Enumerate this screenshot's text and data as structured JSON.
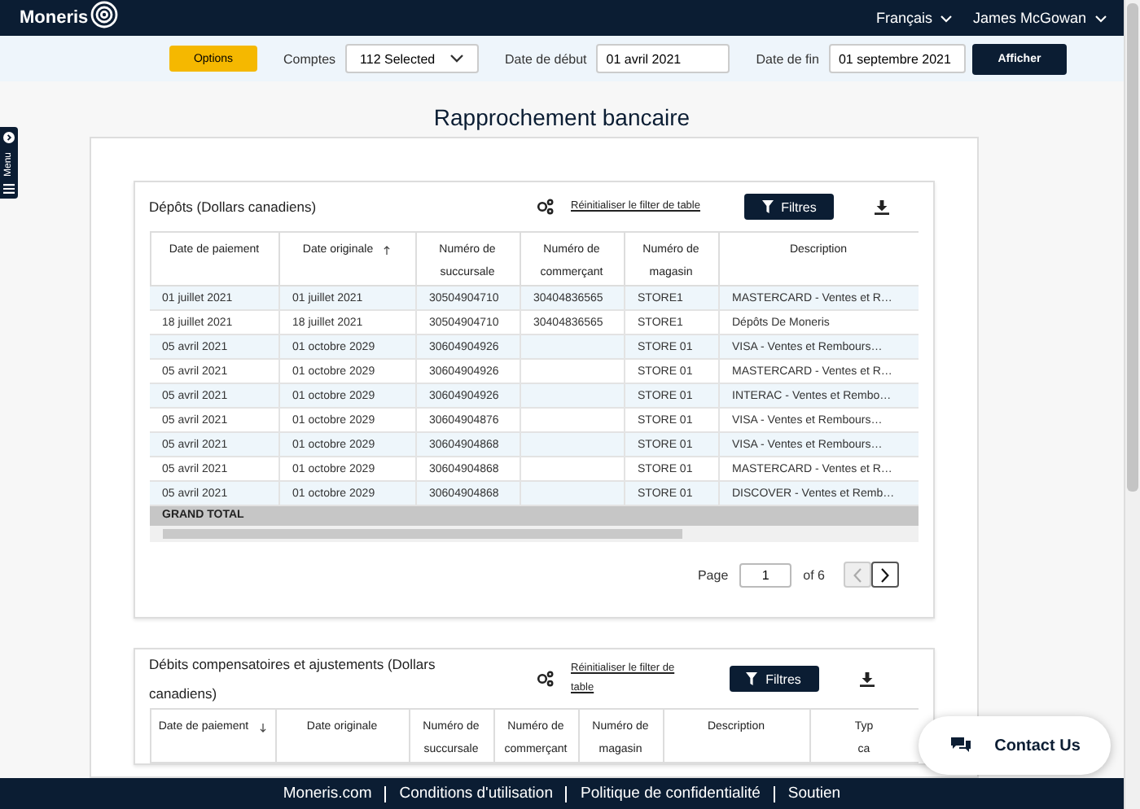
{
  "header": {
    "logo": "Moneris",
    "language": "Français",
    "user": "James McGowan"
  },
  "toolbar": {
    "options_button": "Options",
    "accounts": {
      "label": "Comptes",
      "value": "112 Selected"
    },
    "start_date": {
      "label": "Date de début",
      "value": "01 avril 2021"
    },
    "end_date": {
      "label": "Date de fin",
      "value": "01 septembre 2021"
    },
    "submit_button": "Afficher"
  },
  "side_menu": {
    "label": "Menu"
  },
  "page_title": "Rapprochement bancaire",
  "sections": [
    {
      "title": "Dépôts (Dollars canadiens)",
      "reset_link": "Réinitialiser le filter de table",
      "filter_button": "Filtres",
      "columns": [
        {
          "label": "Date de paiement",
          "sorted": false
        },
        {
          "label": "Date originale",
          "sorted": true,
          "ascending": true
        },
        {
          "label": "Numéro de succursale",
          "sorted": false
        },
        {
          "label": "Numéro de commerçant",
          "sorted": false
        },
        {
          "label": "Numéro de magasin",
          "sorted": false
        },
        {
          "label": "Description",
          "sorted": false
        }
      ],
      "rows": [
        [
          "01 juillet 2021",
          "01 juillet 2021",
          "30504904710",
          "30404836565",
          "STORE1",
          "MASTERCARD - Ventes et R…"
        ],
        [
          "18 juillet 2021",
          "18 juillet 2021",
          "30504904710",
          "30404836565",
          "STORE1",
          "Dépôts De Moneris"
        ],
        [
          "05 avril 2021",
          "01 octobre 2029",
          "30604904926",
          null,
          "STORE 01",
          "VISA - Ventes et Rembours…"
        ],
        [
          "05 avril 2021",
          "01 octobre 2029",
          "30604904926",
          null,
          "STORE 01",
          "MASTERCARD - Ventes et R…"
        ],
        [
          "05 avril 2021",
          "01 octobre 2029",
          "30604904926",
          null,
          "STORE 01",
          "INTERAC - Ventes et Rembo…"
        ],
        [
          "05 avril 2021",
          "01 octobre 2029",
          "30604904876",
          null,
          "STORE 01",
          "VISA - Ventes et Rembours…"
        ],
        [
          "05 avril 2021",
          "01 octobre 2029",
          "30604904868",
          null,
          "STORE 01",
          "VISA - Ventes et Rembours…"
        ],
        [
          "05 avril 2021",
          "01 octobre 2029",
          "30604904868",
          null,
          "STORE 01",
          "MASTERCARD - Ventes et R…"
        ],
        [
          "05 avril 2021",
          "01 octobre 2029",
          "30604904868",
          null,
          "STORE 01",
          "DISCOVER - Ventes et Remb…"
        ]
      ],
      "total_label": "GRAND TOTAL",
      "pagination": {
        "label": "Page",
        "value": "1",
        "of": "of 6",
        "prev_disabled": true,
        "next_disabled": false
      }
    },
    {
      "title": "Débits compensatoires et ajustements (Dollars canadiens)",
      "reset_link": "Réinitialiser le filter de table",
      "filter_button": "Filtres",
      "columns": [
        {
          "label": "Date de paiement",
          "sorted": true,
          "ascending": false
        },
        {
          "label": "Date originale",
          "sorted": false
        },
        {
          "label": "Numéro de succursale",
          "sorted": false
        },
        {
          "label": "Numéro de commerçant",
          "sorted": false
        },
        {
          "label": "Numéro de magasin",
          "sorted": false
        },
        {
          "label": "Description",
          "sorted": false
        },
        {
          "label": "Typ ca",
          "sorted": false
        }
      ]
    }
  ],
  "contact_button": "Contact Us",
  "footer_links": [
    "Moneris.com",
    "Conditions d'utilisation",
    "Politique de confidentialité",
    "Soutien"
  ]
}
